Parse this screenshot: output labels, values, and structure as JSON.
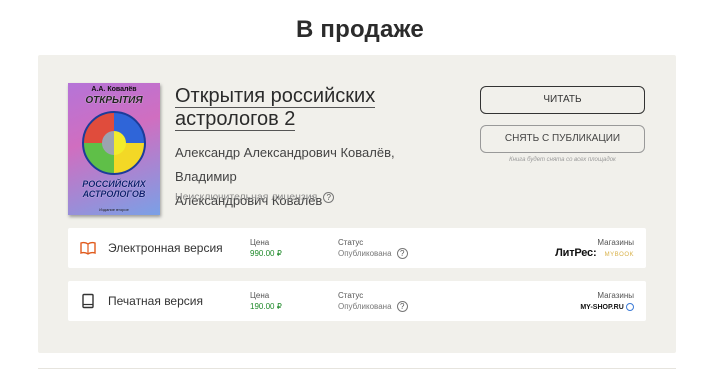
{
  "page": {
    "title": "В продаже"
  },
  "book": {
    "cover": {
      "author": "А.А. Ковалёв",
      "title_top": "ОТКРЫТИЯ",
      "title_bottom_1": "РОССИЙСКИХ",
      "title_bottom_2": "АСТРОЛОГОВ",
      "edition": "Издание второе"
    },
    "title": "Открытия российских астрологов 2",
    "authors_line1": "Александр Александрович Ковалёв, Владимир",
    "authors_line2": "Александрович Ковалёв",
    "license": "Неисключительная лицензия",
    "help_glyph": "?"
  },
  "actions": {
    "read_label": "Читать",
    "unpublish_label": "Снять с публикации",
    "unpublish_note": "Книга будет снята со всех площадок"
  },
  "versions": [
    {
      "label": "Электронная версия",
      "icon": "book-open-icon",
      "price_label": "Цена",
      "price_value": "990.00 ₽",
      "status_label": "Статус",
      "status_value": "Опубликована",
      "stores_label": "Магазины",
      "stores": [
        "ЛитРес:",
        "MYBOOK"
      ]
    },
    {
      "label": "Печатная версия",
      "icon": "book-closed-icon",
      "price_label": "Цена",
      "price_value": "190.00 ₽",
      "status_label": "Статус",
      "status_value": "Опубликована",
      "stores_label": "Магазины",
      "stores": [
        "MY-SHOP.RU"
      ]
    }
  ],
  "colors": {
    "accent": "#e05a1c",
    "price": "#1f8a2a",
    "panel": "#f1f0eb"
  }
}
